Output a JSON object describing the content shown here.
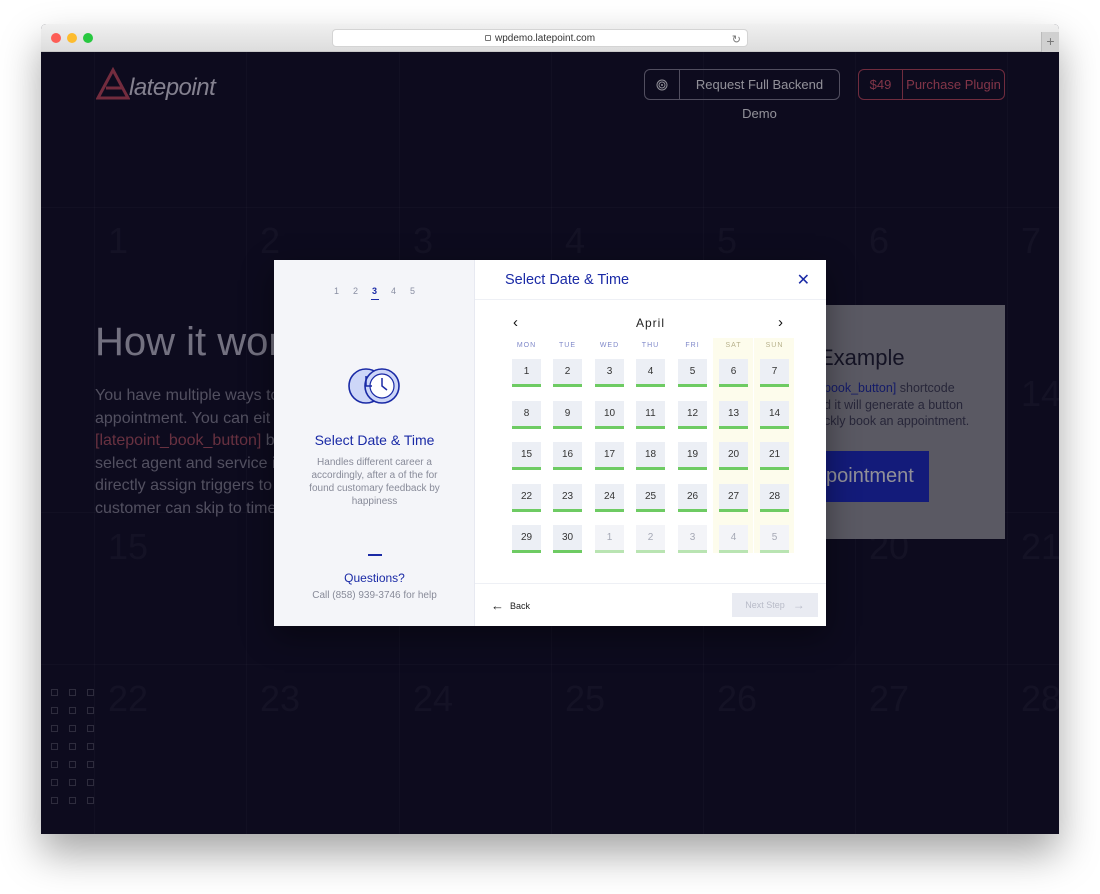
{
  "browser": {
    "url": "wpdemo.latepoint.com"
  },
  "header": {
    "logo_text": "latepoint",
    "demo_button_label": "Request Full Backend Demo",
    "price_label": "$49",
    "purchase_label": "Purchase Plugin"
  },
  "hero": {
    "title": "How it wor",
    "text_line_1": "You have multiple ways to",
    "text_line_2": "appointment. You can eit",
    "text_code": "[latepoint_book_button]",
    "text_line_3_suffix": " b",
    "text_line_4": "select agent and service i",
    "text_line_5": "directly assign triggers to",
    "text_line_6": "customer can skip to time"
  },
  "example": {
    "title": "Example",
    "code": "book_button]",
    "desc_1": " shortcode",
    "desc_2": "d it will generate a button",
    "desc_3": "ckly book an appointment.",
    "button_label": "pointment"
  },
  "background_numbers": [
    "1",
    "2",
    "3",
    "4",
    "5",
    "6",
    "7",
    "15",
    "20",
    "21",
    "22",
    "23",
    "24",
    "25",
    "26",
    "27",
    "28",
    "14"
  ],
  "modal": {
    "steps": [
      "1",
      "2",
      "3",
      "4",
      "5"
    ],
    "active_step": "3",
    "side_title": "Select Date & Time",
    "side_desc": "Handles different career a accordingly, after a of the for found customary feedback by happiness",
    "questions_title": "Questions?",
    "questions_call": "Call (858) 939-3746 for help",
    "main_title": "Select Date & Time",
    "close_icon": "close-icon",
    "month": "April",
    "weekdays": [
      "MON",
      "TUE",
      "WED",
      "THU",
      "FRI",
      "SAT",
      "SUN"
    ],
    "days": [
      [
        "1",
        "2",
        "3",
        "4",
        "5",
        "6",
        "7"
      ],
      [
        "8",
        "9",
        "10",
        "11",
        "12",
        "13",
        "14"
      ],
      [
        "15",
        "16",
        "17",
        "18",
        "19",
        "20",
        "21"
      ],
      [
        "22",
        "23",
        "24",
        "25",
        "26",
        "27",
        "28"
      ],
      [
        "29",
        "30",
        "1",
        "2",
        "3",
        "4",
        "5"
      ]
    ],
    "back_label": "Back",
    "next_label": "Next Step",
    "colors": {
      "accent": "#1a2aa6",
      "available": "#6ecb63",
      "weekend_bg": "#fdfcec"
    }
  }
}
